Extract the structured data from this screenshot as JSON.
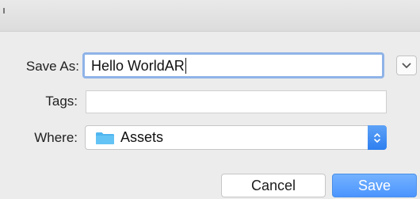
{
  "dialog": {
    "save_as_label": "Save As:",
    "file_name": "Hello WorldAR",
    "tags_label": "Tags:",
    "tags_value": "",
    "where_label": "Where:",
    "where_value": "Assets"
  },
  "buttons": {
    "cancel_label": "Cancel",
    "save_label": "Save"
  },
  "icons": {
    "expand": "chevron-down-icon",
    "folder": "folder-icon",
    "stepper": "up-down-arrows-icon"
  },
  "colors": {
    "accent": "#4c95ff",
    "focus_ring": "#8fb3e8",
    "folder": "#4fb6f0"
  }
}
